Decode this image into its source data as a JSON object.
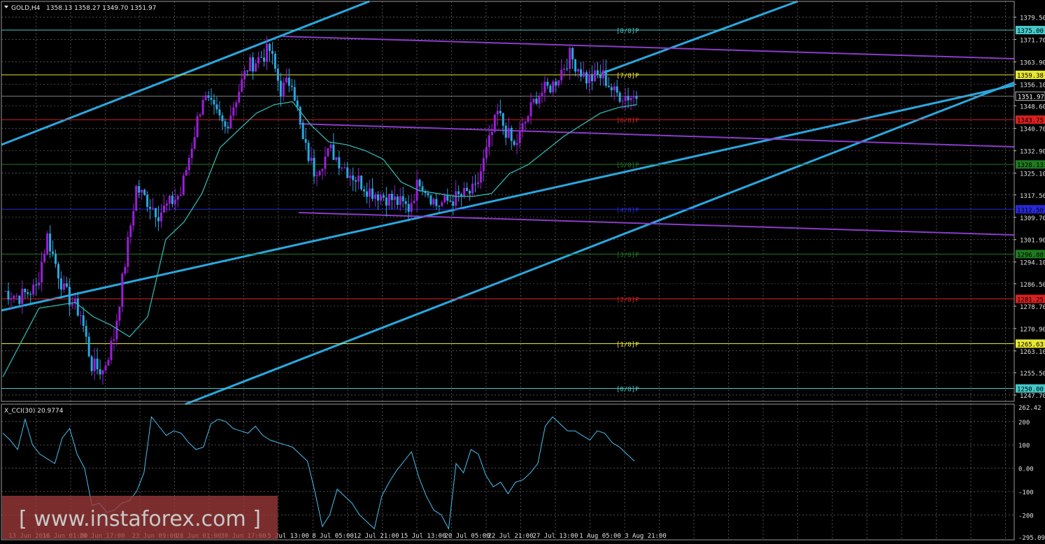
{
  "header": {
    "symbol": "GOLD,H4",
    "ohlc": "1358.13 1358.27 1349.70 1351.97",
    "indicator": "X_CCI(30) 20.9774"
  },
  "watermark": "[ www.instaforex.com ]",
  "colors": {
    "background": "#000000",
    "grid": "#7f7f7f",
    "bull": "#9a1fd6",
    "bear": "#29a8e0",
    "channel": "#29a8e0",
    "ma": "#2fb5b0",
    "pitchfork": "#8a3cc8",
    "cci": "#47bff0"
  },
  "chart_data": [
    {
      "type": "candlestick",
      "title": "GOLD,H4 1358.13 1358.27 1349.70 1351.97",
      "y_ticks": [
        "1379.50",
        "1371.70",
        "1363.90",
        "1356.10",
        "1348.60",
        "1340.70",
        "1332.90",
        "1325.10",
        "1317.50",
        "1309.70",
        "1301.90",
        "1294.10",
        "1286.50",
        "1278.70",
        "1270.90",
        "1263.10",
        "1255.50",
        "1247.70"
      ],
      "ylim": [
        1245.5,
        1385.0
      ],
      "x_labels": [
        "13 Jun 2016",
        "16 Jun 01:00",
        "20 Jun 17:00",
        "23 Jun 09:00",
        "28 Jun 01:00",
        "30 Jun 17:00",
        "5 Jul 13:00",
        "8 Jul 05:00",
        "12 Jul 21:00",
        "15 Jul 13:00",
        "20 Jul 05:00",
        "22 Jul 21:00",
        "27 Jul 13:00",
        "1 Aug 05:00",
        "3 Aug 21:00"
      ],
      "last_price": "1351.97",
      "levels": [
        {
          "label": "[8/8]P",
          "price": "1375.00",
          "value": 1375.0,
          "color": "#46c8c8"
        },
        {
          "label": "[7/8]P",
          "price": "1359.38",
          "value": 1359.38,
          "color": "#e8e832"
        },
        {
          "label": "[6/8]P",
          "price": "1343.75",
          "value": 1343.75,
          "color": "#d82020"
        },
        {
          "label": "[5/8]P",
          "price": "1328.13",
          "value": 1328.13,
          "color": "#1e7a1e"
        },
        {
          "label": "[4/8]P",
          "price": "1312.50",
          "value": 1312.5,
          "color": "#2828d8"
        },
        {
          "label": "[3/8]P",
          "price": "1296.88",
          "value": 1296.88,
          "color": "#1e7a1e"
        },
        {
          "label": "[2/8]P",
          "price": "1281.25",
          "value": 1281.25,
          "color": "#d82020"
        },
        {
          "label": "[1/8]P",
          "price": "1265.63",
          "value": 1265.63,
          "color": "#e8e832"
        },
        {
          "label": "[0/8]P",
          "price": "1250.00",
          "value": 1250.0,
          "color": "#46c8c8"
        }
      ],
      "path_points_x_idx": [
        0,
        6,
        12,
        16,
        22,
        28,
        32,
        36,
        40,
        48,
        56,
        64,
        72,
        80,
        88,
        96,
        100,
        104,
        108,
        112,
        118,
        124,
        132,
        140,
        146,
        150,
        156,
        162,
        170,
        178,
        184,
        192,
        198,
        204,
        210,
        216,
        220,
        224,
        228
      ],
      "path_points_y": [
        1284,
        1282,
        1285,
        1303,
        1284,
        1276,
        1258,
        1256,
        1268,
        1320,
        1311,
        1318,
        1352,
        1341,
        1362,
        1368,
        1354,
        1358,
        1336,
        1326,
        1333,
        1326,
        1319,
        1316,
        1313,
        1323,
        1314,
        1316,
        1319,
        1346,
        1334,
        1352,
        1356,
        1366,
        1358,
        1359,
        1353,
        1352,
        1352
      ],
      "ma_points_y": [
        1254,
        1266,
        1278,
        1279,
        1280,
        1275,
        1272,
        1268,
        1275,
        1302,
        1308,
        1318,
        1334,
        1340,
        1346,
        1349,
        1350,
        1342,
        1336,
        1335,
        1333,
        1330,
        1322,
        1319,
        1318,
        1317,
        1317,
        1318,
        1325,
        1328,
        1333,
        1338,
        1342,
        1346,
        1348,
        1349
      ]
    },
    {
      "type": "line",
      "title": "X_CCI(30) 20.9774",
      "y_ticks": [
        "262.42",
        "200",
        "100",
        "0.00",
        "-100",
        "-200",
        "-295.09"
      ],
      "ylim": [
        -295.09,
        262.42
      ],
      "values": [
        150,
        120,
        80,
        210,
        100,
        60,
        40,
        20,
        130,
        170,
        60,
        0,
        -160,
        -150,
        -190,
        -180,
        -150,
        -140,
        -100,
        -20,
        220,
        180,
        140,
        160,
        150,
        110,
        80,
        90,
        190,
        210,
        200,
        170,
        160,
        150,
        180,
        140,
        120,
        110,
        100,
        90,
        60,
        30,
        -100,
        -250,
        -200,
        -90,
        -120,
        -150,
        -200,
        -230,
        -260,
        -120,
        -60,
        -10,
        30,
        70,
        -40,
        -120,
        -180,
        -200,
        -260,
        20,
        -20,
        80,
        60,
        -30,
        -80,
        -60,
        -110,
        -60,
        -50,
        -20,
        20,
        180,
        220,
        190,
        160,
        160,
        140,
        120,
        160,
        150,
        110,
        90,
        60,
        30
      ]
    }
  ]
}
